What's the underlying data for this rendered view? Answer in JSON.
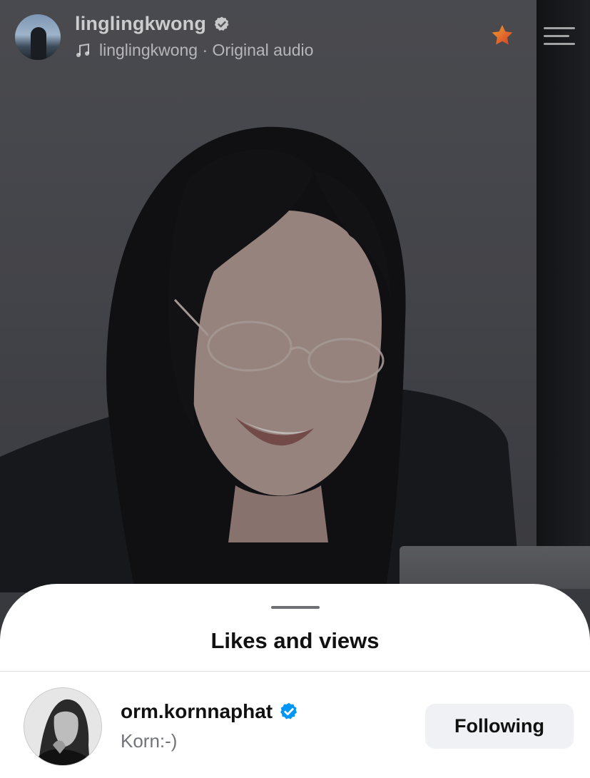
{
  "header": {
    "username": "linglingkwong",
    "audio_label": "linglingkwong · Original audio",
    "avatar_icon": "profile-avatar",
    "verified_icon": "verified-badge-icon",
    "music_icon": "music-note-icon",
    "star_icon": "star-icon",
    "menu_icon": "menu-icon"
  },
  "sheet": {
    "title": "Likes and views",
    "users": [
      {
        "username": "orm.kornnaphat",
        "full_name": "Korn:-)",
        "verified": true,
        "button_label": "Following"
      }
    ]
  },
  "colors": {
    "verified_blue": "#0095f6",
    "star_orange": "#e8672a",
    "button_bg": "#eff1f4"
  }
}
